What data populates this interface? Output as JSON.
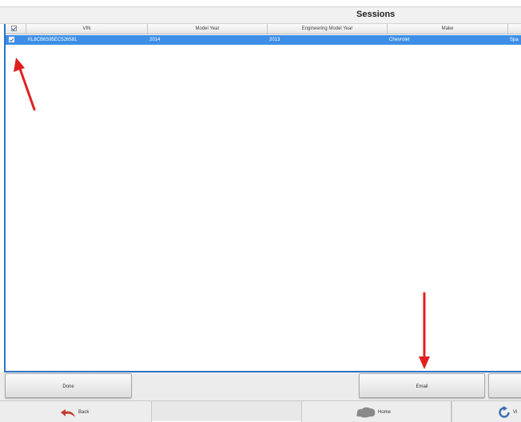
{
  "window": {
    "title": "Sessions"
  },
  "table": {
    "columns": [
      "VIN",
      "Model Year",
      "Engineering Model Year",
      "Make"
    ],
    "rows": [
      {
        "checked": true,
        "vin": "KL8CB6S95EC526581",
        "model_year": "2014",
        "engineering_model_year": "2013",
        "make": "Chevrolet",
        "model": "Spa"
      }
    ]
  },
  "actions": {
    "done_label": "Done",
    "email_label": "Email"
  },
  "nav": {
    "back_label": "Back",
    "home_label": "Home",
    "view_label": "Vi"
  },
  "colors": {
    "selection": "#3d8ee6",
    "frame": "#2b73c9",
    "annotation_arrow": "#e02020"
  },
  "icons": [
    "checkbox-icon",
    "back-arrow-icon",
    "home-icon",
    "refresh-icon"
  ]
}
